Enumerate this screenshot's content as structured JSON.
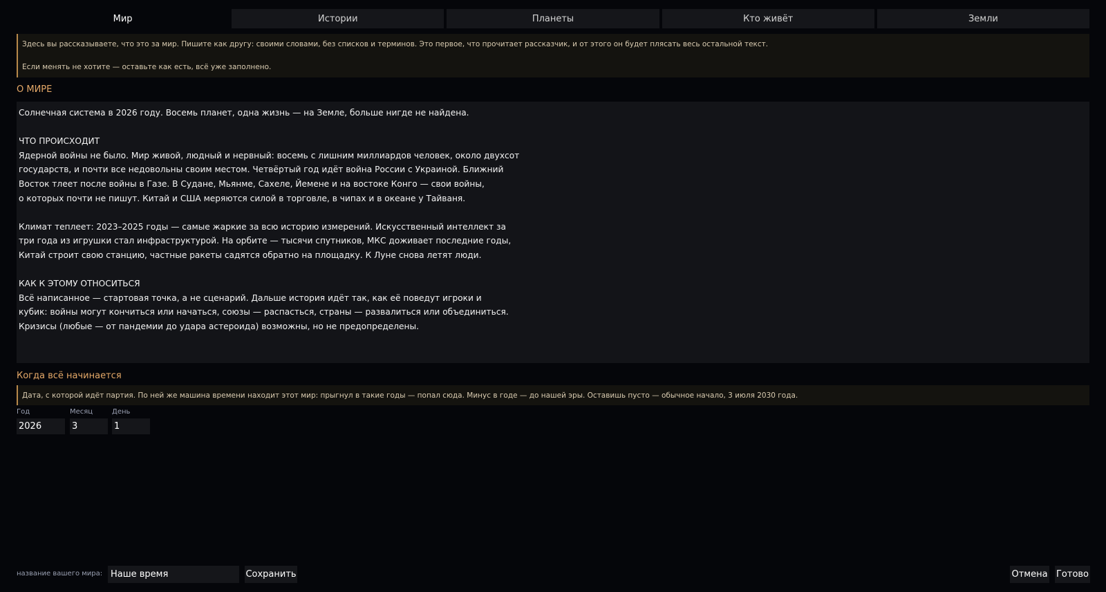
{
  "tabs": [
    {
      "label": "Мир",
      "active": true
    },
    {
      "label": "Истории"
    },
    {
      "label": "Планеты"
    },
    {
      "label": "Кто живёт"
    },
    {
      "label": "Земли"
    }
  ],
  "intro_note": {
    "line1": "Здесь вы рассказываете, что это за мир. Пишите как другу: своими словами, без списков и терминов. Это первое, что прочитает рассказчик, и от этого он будет плясать весь остальной текст.",
    "line2": "Если менять не хотите — оставьте как есть, всё уже заполнено."
  },
  "about": {
    "title": "О МИРЕ",
    "text": "Солнечная система в 2026 году. Восемь планет, одна жизнь — на Земле, больше нигде не найдена.\n\nЧТО ПРОИСХОДИТ\nЯдерной войны не было. Мир живой, людный и нервный: восемь с лишним миллиардов человек, около двухсот\nгосударств, и почти все недовольны своим местом. Четвёртый год идёт война России с Украиной. Ближний\nВосток тлеет после войны в Газе. В Судане, Мьянме, Сахеле, Йемене и на востоке Конго — свои войны,\nо которых почти не пишут. Китай и США меряются силой в торговле, в чипах и в океане у Тайваня.\n\nКлимат теплеет: 2023–2025 годы — самые жаркие за всю историю измерений. Искусственный интеллект за\nтри года из игрушки стал инфраструктурой. На орбите — тысячи спутников, МКС доживает последние годы,\nКитай строит свою станцию, частные ракеты садятся обратно на площадку. К Луне снова летят люди.\n\nКАК К ЭТОМУ ОТНОСИТЬСЯ\nВсё написанное — стартовая точка, а не сценарий. Дальше история идёт так, как её поведут игроки и\nкубик: войны могут кончиться или начаться, союзы — распасться, страны — развалиться или объединиться.\nКризисы (любые — от пандемии до удара астероида) возможны, но не предопределены."
  },
  "start": {
    "title": "Когда всё начинается",
    "note": "Дата, с которой идёт партия. По ней же машина времени находит этот мир: прыгнул в такие годы — попал сюда. Минус в годе — до нашей эры. Оставишь пусто — обычное начало, 3 июля 2030 года.",
    "year_label": "Год",
    "year_value": "2026",
    "month_label": "Месяц",
    "month_value": "3",
    "day_label": "День",
    "day_value": "1"
  },
  "footer": {
    "name_label": "название вашего мира:",
    "name_value": "Наше время",
    "save_label": "Сохранить",
    "cancel_label": "Отмена",
    "done_label": "Готово"
  },
  "colors": {
    "background": "#05060a",
    "accent": "#e4a868",
    "note_border": "#b8894a"
  }
}
